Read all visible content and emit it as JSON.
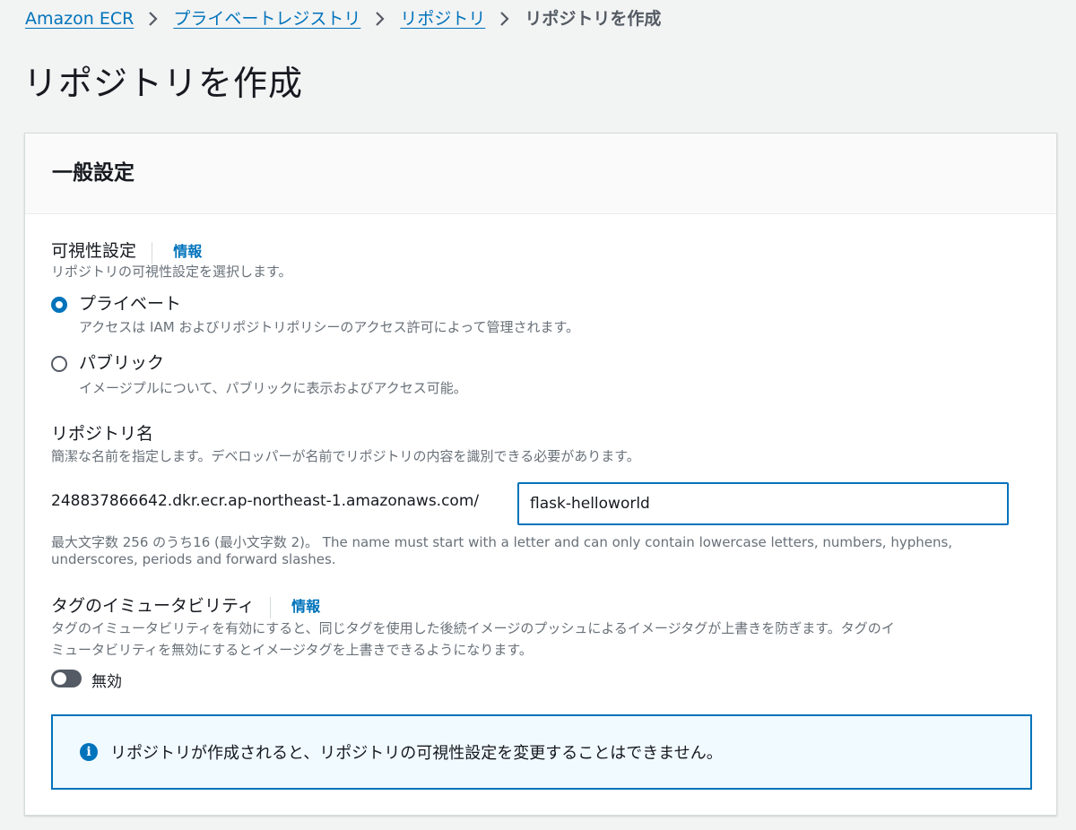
{
  "breadcrumb": {
    "items": [
      "Amazon ECR",
      "プライベートレジストリ",
      "リポジトリ"
    ],
    "current": "リポジトリを作成"
  },
  "page_title": "リポジトリを作成",
  "panel": {
    "header": "一般設定",
    "visibility": {
      "label": "可視性設定",
      "info": "情報",
      "description": "リポジトリの可視性設定を選択します。",
      "selected": "private",
      "options": [
        {
          "label": "プライベート",
          "description": "アクセスは IAM およびリポジトリポリシーのアクセス許可によって管理されます。"
        },
        {
          "label": "パブリック",
          "description": "イメージプルについて、パブリックに表示およびアクセス可能。"
        }
      ]
    },
    "repo_name": {
      "label": "リポジトリ名",
      "description": "簡潔な名前を指定します。デベロッパーが名前でリポジトリの内容を識別できる必要があります。",
      "prefix": "248837866642.dkr.ecr.ap-northeast-1.amazonaws.com/",
      "value": "flask-helloworld",
      "hint_line1": "最大文字数 256 のうち16 (最小文字数 2)。 The name must start with a letter and can only contain lowercase letters, numbers, hyphens,",
      "hint_line2": "underscores, periods and forward slashes."
    },
    "tag_immutability": {
      "label": "タグのイミュータビリティ",
      "info": "情報",
      "description_line1": "タグのイミュータビリティを有効にすると、同じタグを使用した後続イメージのプッシュによるイメージタグが上書きを防ぎます。タグのイ",
      "description_line2": "ミュータビリティを無効にするとイメージタグを上書きできるようになります。",
      "toggle_label": "無効",
      "enabled": false
    },
    "alert": {
      "icon": "info-icon",
      "text": "リポジトリが作成されると、リポジトリの可視性設定を変更することはできません。"
    }
  },
  "colors": {
    "accent": "#0073bb",
    "background": "#f2f3f3",
    "alert_background": "#f1faff"
  }
}
